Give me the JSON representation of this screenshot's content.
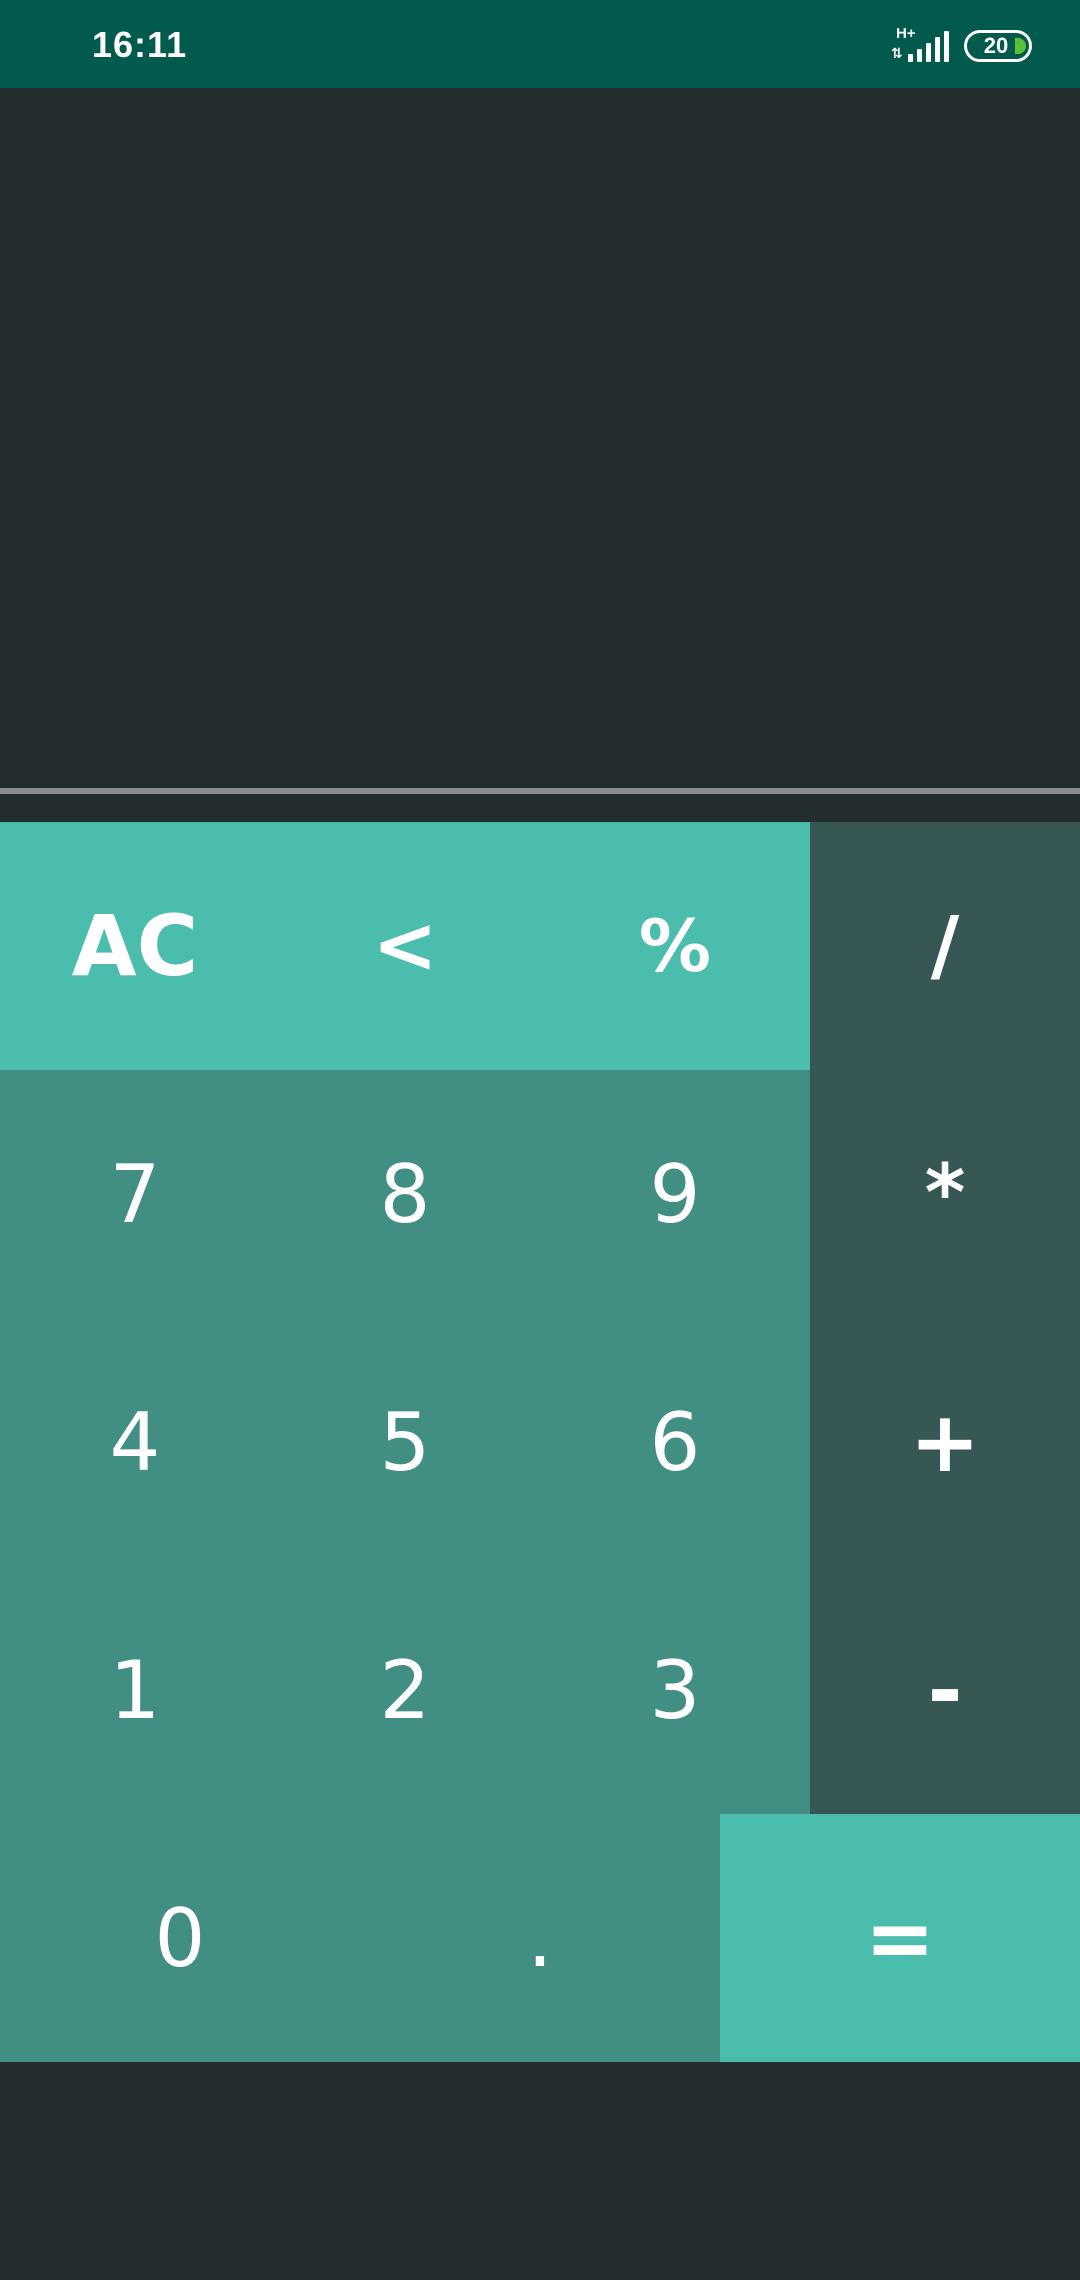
{
  "status_bar": {
    "time": "16:11",
    "network_type": "H+",
    "network_arrows": "⇅",
    "battery_level": "20",
    "battery_fill_color": "#58c23b",
    "signal_icon": "cellular-signal-icon"
  },
  "display": {
    "result": ""
  },
  "keys": {
    "clear": "AC",
    "backspace": "<",
    "percent": "%",
    "divide": "/",
    "seven": "7",
    "eight": "8",
    "nine": "9",
    "multiply": "*",
    "four": "4",
    "five": "5",
    "six": "6",
    "plus": "+",
    "one": "1",
    "two": "2",
    "three": "3",
    "minus": "-",
    "zero": "0",
    "decimal": ".",
    "equals": "="
  },
  "colors": {
    "status_bar": "#025a4c",
    "background": "#232d2d",
    "top_keys": "#4bbdac",
    "number_keys": "#418e82",
    "operator_keys": "#365753",
    "equals_key": "#4bbdac"
  }
}
